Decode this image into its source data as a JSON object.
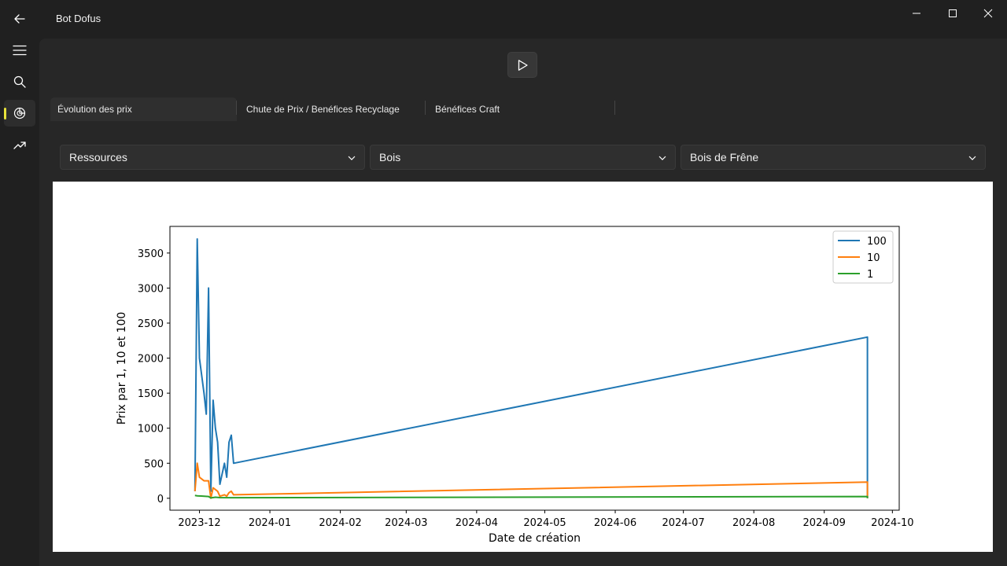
{
  "window": {
    "title": "Bot Dofus"
  },
  "nav": {
    "items": [
      {
        "name": "menu-icon"
      },
      {
        "name": "search-icon"
      },
      {
        "name": "chart-icon",
        "selected": true
      },
      {
        "name": "trending-icon"
      }
    ],
    "accent_color": "#e8e23a"
  },
  "toolbar": {
    "play_icon": "play-icon"
  },
  "tabs": [
    {
      "label": "Évolution des prix",
      "selected": true
    },
    {
      "label": "Chute de Prix / Benéfices Recyclage"
    },
    {
      "label": "Bénéfices Craft"
    }
  ],
  "filters": {
    "category": "Ressources",
    "type": "Bois",
    "item": "Bois de Frêne"
  },
  "chart_data": {
    "type": "line",
    "title": "",
    "xlabel": "Date de création",
    "ylabel": "Prix par 1, 10 et 100",
    "ylim": [
      -170,
      3880
    ],
    "xlim": [
      "2023-11-18",
      "2024-10-04"
    ],
    "x_ticks": [
      "2023-12",
      "2024-01",
      "2024-02",
      "2024-03",
      "2024-04",
      "2024-05",
      "2024-06",
      "2024-07",
      "2024-08",
      "2024-09",
      "2024-10"
    ],
    "y_ticks": [
      0,
      500,
      1000,
      1500,
      2000,
      2500,
      3000,
      3500
    ],
    "legend_position": "top-right",
    "grid": false,
    "series": [
      {
        "name": "100",
        "color": "#1f77b4",
        "points": [
          [
            "2023-11-29",
            100
          ],
          [
            "2023-11-30",
            3700
          ],
          [
            "2023-12-01",
            2000
          ],
          [
            "2023-12-03",
            1500
          ],
          [
            "2023-12-04",
            1200
          ],
          [
            "2023-12-05",
            3000
          ],
          [
            "2023-12-06",
            100
          ],
          [
            "2023-12-07",
            1400
          ],
          [
            "2023-12-08",
            1000
          ],
          [
            "2023-12-09",
            800
          ],
          [
            "2023-12-10",
            200
          ],
          [
            "2023-12-12",
            500
          ],
          [
            "2023-12-13",
            300
          ],
          [
            "2023-12-14",
            800
          ],
          [
            "2023-12-15",
            900
          ],
          [
            "2023-12-16",
            500
          ],
          [
            "2024-09-20",
            2300
          ],
          [
            "2024-09-20",
            0
          ]
        ]
      },
      {
        "name": "10",
        "color": "#ff7f0e",
        "points": [
          [
            "2023-11-29",
            100
          ],
          [
            "2023-11-30",
            500
          ],
          [
            "2023-12-01",
            300
          ],
          [
            "2023-12-03",
            250
          ],
          [
            "2023-12-05",
            250
          ],
          [
            "2023-12-06",
            0
          ],
          [
            "2023-12-07",
            150
          ],
          [
            "2023-12-09",
            100
          ],
          [
            "2023-12-10",
            30
          ],
          [
            "2023-12-12",
            50
          ],
          [
            "2023-12-13",
            30
          ],
          [
            "2023-12-14",
            80
          ],
          [
            "2023-12-15",
            100
          ],
          [
            "2023-12-16",
            50
          ],
          [
            "2024-09-20",
            230
          ],
          [
            "2024-09-20",
            0
          ]
        ]
      },
      {
        "name": "1",
        "color": "#2ca02c",
        "points": [
          [
            "2023-11-29",
            40
          ],
          [
            "2023-11-30",
            35
          ],
          [
            "2023-12-05",
            25
          ],
          [
            "2023-12-06",
            5
          ],
          [
            "2023-12-08",
            15
          ],
          [
            "2023-12-10",
            10
          ],
          [
            "2023-12-16",
            8
          ],
          [
            "2024-09-20",
            25
          ],
          [
            "2024-09-20",
            0
          ]
        ]
      }
    ]
  }
}
